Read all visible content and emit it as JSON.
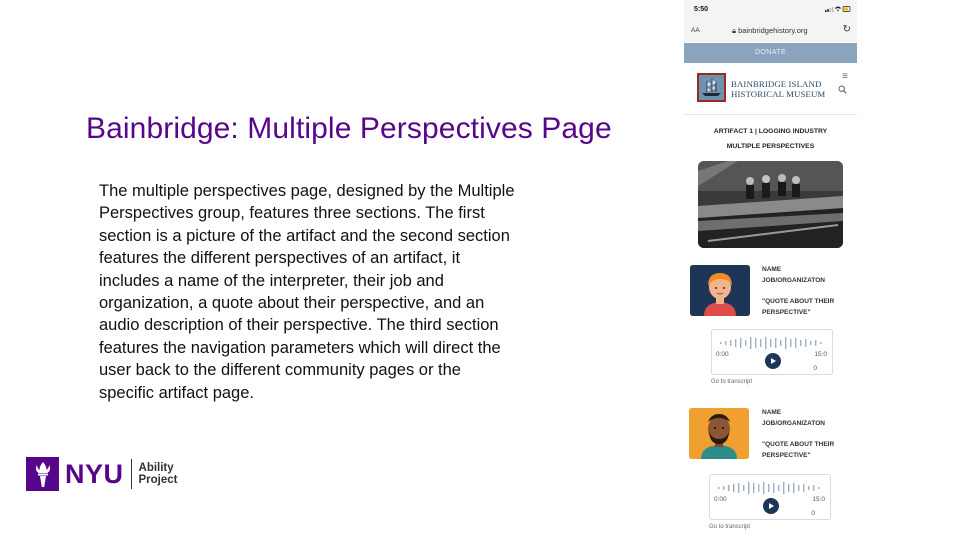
{
  "slide": {
    "title": "Bainbridge: Multiple Perspectives Page",
    "body": "The multiple perspectives page, designed by the Multiple Perspectives group, features three sections. The first section is a picture of the artifact and the second section features the different perspectives of an artifact, it includes a name of the interpreter, their job and organization, a quote about their perspective, and an audio description of their perspective. The third section features the navigation parameters which will direct the user back to the different community pages or the specific artifact page."
  },
  "logo": {
    "brand": "NYU",
    "sub_line1": "Ability",
    "sub_line2": "Project",
    "color": "#57068c"
  },
  "phone": {
    "status_time": "5:50",
    "url_aa": "AA",
    "url": "bainbridgehistory.org",
    "donate_label": "DONATE",
    "museum_line1": "BAINBRIDGE ISLAND",
    "museum_line2": "HISTORICAL MUSEUM",
    "artifact_label": "ARTIFACT 1 | LOGGING INDUSTRY",
    "section_label": "MULTIPLE PERSPECTIVES",
    "perspectives": [
      {
        "name": "NAME",
        "job": "JOB/ORGANIZATON",
        "quote": "\"QUOTE ABOUT THEIR PERSPECTIVE\"",
        "audio_start": "0:00",
        "audio_end": "15:0",
        "audio_end_extra": "0",
        "transcript": "Go to transcript"
      },
      {
        "name": "NAME",
        "job": "JOB/ORGANIZATON",
        "quote": "\"QUOTE ABOUT THEIR PERSPECTIVE\"",
        "audio_start": "0:00",
        "audio_end": "15:0",
        "audio_end_extra": "0",
        "transcript": "Go to transcript"
      }
    ]
  }
}
